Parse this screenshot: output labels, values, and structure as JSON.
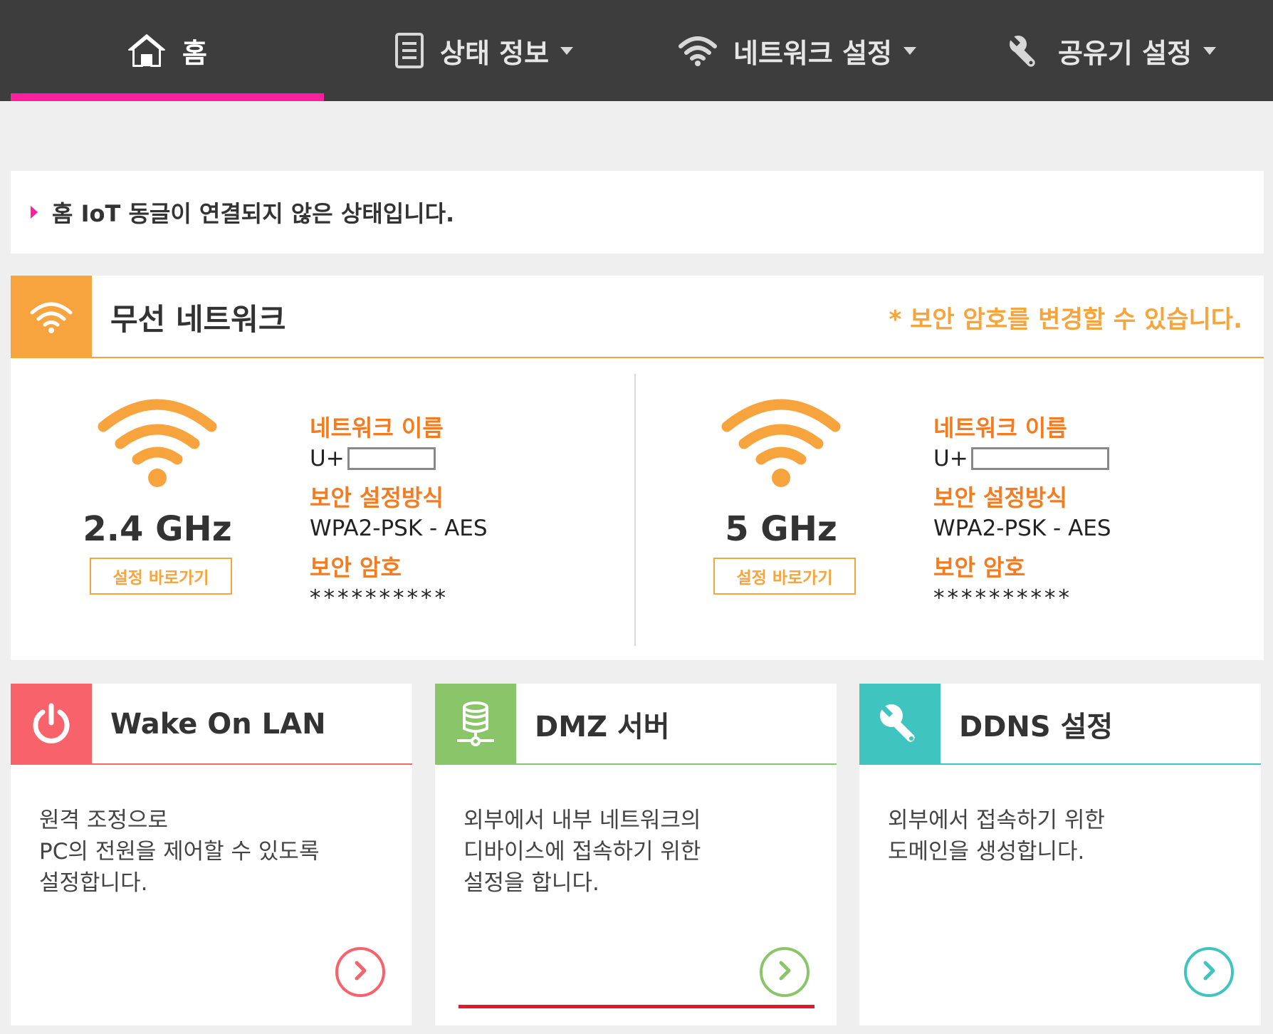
{
  "nav": {
    "home_label": "홈",
    "status_label": "상태 정보",
    "network_label": "네트워크 설정",
    "router_label": "공유기 설정"
  },
  "notice": {
    "text": "홈 IoT 동글이 연결되지 않은 상태입니다."
  },
  "wireless": {
    "title": "무선 네트워크",
    "hint": "* 보안 암호를 변경할 수 있습니다.",
    "bands": [
      {
        "freq": "2.4 GHz",
        "button": "설정 바로가기",
        "name_label": "네트워크 이름",
        "ssid_prefix": "U+",
        "security_label": "보안 설정방식",
        "security_value": "WPA2-PSK - AES",
        "password_label": "보안 암호",
        "password_value": "**********"
      },
      {
        "freq": "5 GHz",
        "button": "설정 바로가기",
        "name_label": "네트워크 이름",
        "ssid_prefix": "U+",
        "security_label": "보안 설정방식",
        "security_value": "WPA2-PSK - AES",
        "password_label": "보안 암호",
        "password_value": "**********"
      }
    ]
  },
  "cards": [
    {
      "title": "Wake On LAN",
      "lines": [
        "원격 조정으로",
        "PC의 전원을 제어할 수 있도록",
        "설정합니다."
      ],
      "icon": "power-icon",
      "color": "#f7626b"
    },
    {
      "title": "DMZ 서버",
      "lines": [
        "외부에서 내부 네트워크의",
        "디바이스에 접속하기 위한",
        "설정을 합니다."
      ],
      "icon": "server-icon",
      "color": "#8bc56a"
    },
    {
      "title": "DDNS 설정",
      "lines": [
        "외부에서 접속하기 위한",
        "도메인을 생성합니다."
      ],
      "icon": "wrench-icon",
      "color": "#3fc4c0"
    }
  ],
  "colors": {
    "nav_bg": "#3d3d3d",
    "nav_active": "#ff1f9a",
    "accent_orange": "#f6a53c",
    "label_orange": "#f47b20"
  }
}
